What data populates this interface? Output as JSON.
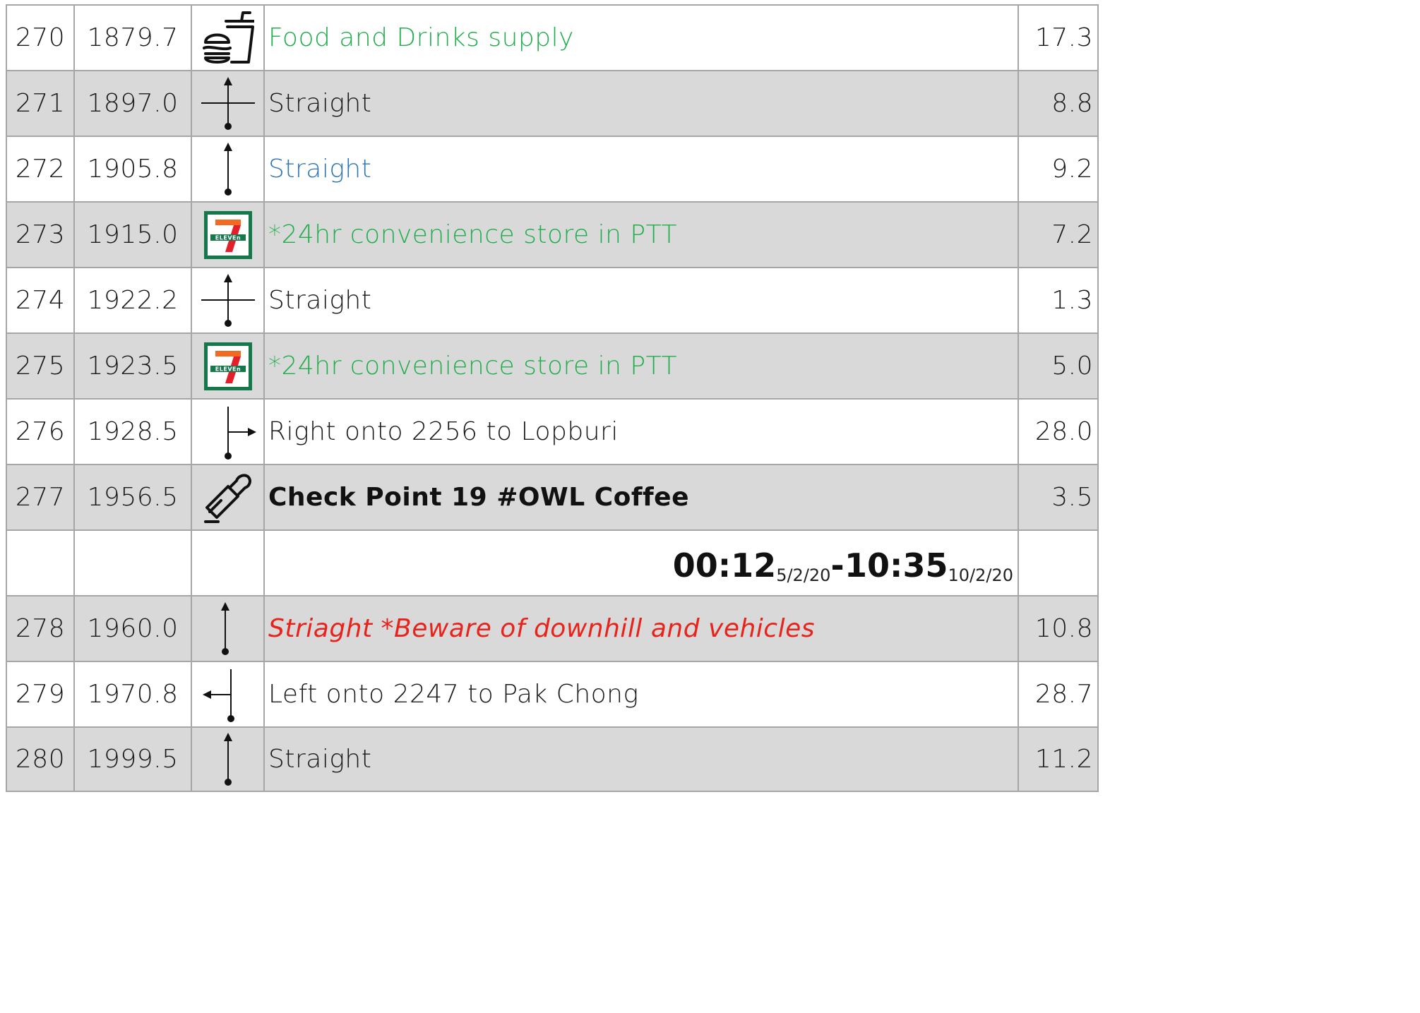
{
  "rows": [
    {
      "no": "270",
      "km": "1879.7",
      "icon": "food-drinks-icon",
      "desc": "Food and Drinks supply",
      "dist": "17.3"
    },
    {
      "no": "271",
      "km": "1897.0",
      "icon": "crossroad-straight-icon",
      "desc": "Straight",
      "dist": "8.8"
    },
    {
      "no": "272",
      "km": "1905.8",
      "icon": "arrow-straight-icon",
      "desc": "Straight",
      "dist": "9.2"
    },
    {
      "no": "273",
      "km": "1915.0",
      "icon": "seven-eleven-logo",
      "desc": "*24hr convenience store in PTT",
      "dist": "7.2"
    },
    {
      "no": "274",
      "km": "1922.2",
      "icon": "crossroad-straight-icon",
      "desc": "Straight",
      "dist": "1.3"
    },
    {
      "no": "275",
      "km": "1923.5",
      "icon": "seven-eleven-logo",
      "desc": "*24hr convenience store in PTT",
      "dist": "5.0"
    },
    {
      "no": "276",
      "km": "1928.5",
      "icon": "turn-right-icon",
      "desc": "Right onto 2256 to Lopburi",
      "dist": "28.0"
    },
    {
      "no": "277",
      "km": "1956.5",
      "icon": "checkpoint-stamp-icon",
      "desc": "Check Point 19 #OWL Coffee",
      "dist": "3.5"
    },
    {
      "no": "278",
      "km": "1960.0",
      "icon": "arrow-straight-icon",
      "desc": "Striaght *Beware of downhill and vehicles",
      "dist": "10.8"
    },
    {
      "no": "279",
      "km": "1970.8",
      "icon": "turn-left-icon",
      "desc": "Left onto 2247 to Pak Chong",
      "dist": "28.7"
    },
    {
      "no": "280",
      "km": "1999.5",
      "icon": "arrow-straight-icon",
      "desc": "Straight",
      "dist": "11.2"
    }
  ],
  "time_window": {
    "open_time": "00:12",
    "open_date": "5/2/20",
    "separator": "-",
    "close_time": "10:35",
    "close_date": "10/2/20"
  },
  "seven_eleven_logo_text": "ELEVEn",
  "colors": {
    "shaded_row": "#d9d9d9",
    "grid_line": "#a6a6a6",
    "green_text": "#1fae4b",
    "blue_text": "#2e75b6",
    "red_text": "#e8231b",
    "logo_green": "#14784a",
    "logo_orange": "#f26a21",
    "logo_red": "#e3202a"
  }
}
